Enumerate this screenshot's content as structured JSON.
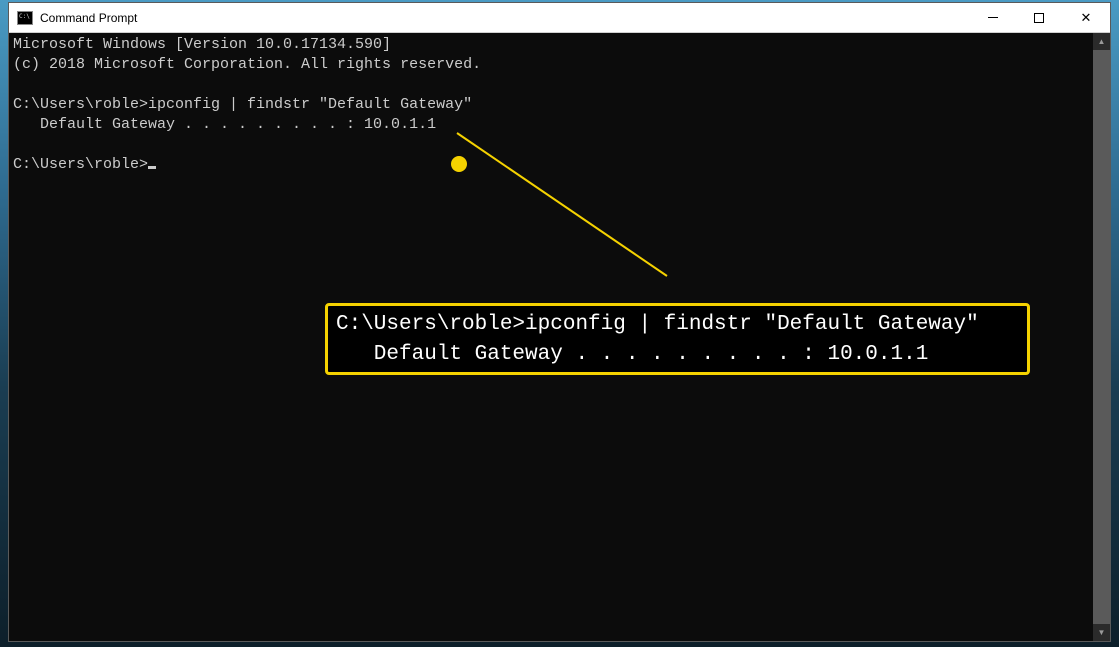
{
  "titlebar": {
    "title": "Command Prompt"
  },
  "terminal": {
    "line1": "Microsoft Windows [Version 10.0.17134.590]",
    "line2": "(c) 2018 Microsoft Corporation. All rights reserved.",
    "line3": "",
    "line4": "C:\\Users\\roble>ipconfig | findstr \"Default Gateway\"",
    "line5": "   Default Gateway . . . . . . . . . : 10.0.1.1",
    "line6": "",
    "line7": "C:\\Users\\roble>"
  },
  "callout": {
    "line1": "C:\\Users\\roble>ipconfig | findstr \"Default Gateway\"",
    "line2": "   Default Gateway . . . . . . . . . : 10.0.1.1"
  }
}
